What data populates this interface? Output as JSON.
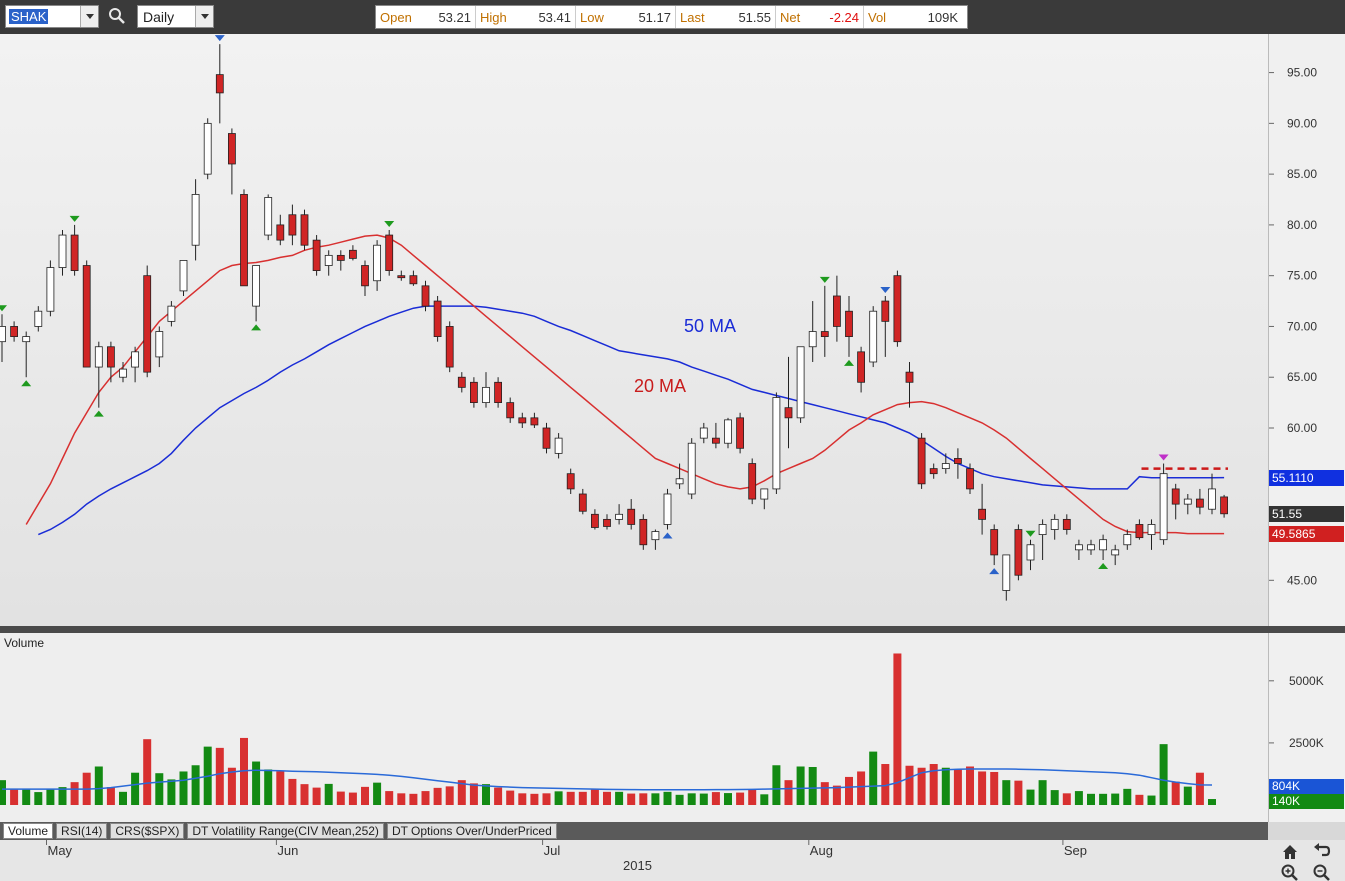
{
  "toolbar": {
    "symbol": "SHAK",
    "period": "Daily",
    "quote": [
      {
        "label": "Open",
        "value": "53.21",
        "negative": false
      },
      {
        "label": "High",
        "value": "53.41",
        "negative": false
      },
      {
        "label": "Low",
        "value": "51.17",
        "negative": false
      },
      {
        "label": "Last",
        "value": "51.55",
        "negative": false
      },
      {
        "label": "Net",
        "value": "-2.24",
        "negative": true
      },
      {
        "label": "Vol",
        "value": "109K",
        "negative": false
      }
    ]
  },
  "price_axis": {
    "labels": [
      "95.00",
      "90.00",
      "85.00",
      "80.00",
      "75.00",
      "70.00",
      "65.00",
      "60.00",
      "45.00"
    ],
    "values": [
      95,
      90,
      85,
      80,
      75,
      70,
      65,
      60,
      45
    ],
    "badges": [
      {
        "text": "55.1110",
        "value": 55.111,
        "color": "#1030e0"
      },
      {
        "text": "51.55",
        "value": 51.55,
        "color": "#333333"
      },
      {
        "text": "49.5865",
        "value": 49.5865,
        "color": "#d02020"
      }
    ]
  },
  "annotations": {
    "ma50_label": "50 MA",
    "ma20_label": "20 MA"
  },
  "volume_pane": {
    "title": "Volume",
    "axis_labels": [
      "5000K",
      "2500K"
    ],
    "axis_values": [
      5000,
      2500
    ],
    "badges": [
      {
        "text": "804K",
        "value": 804,
        "color": "#1a55d6"
      },
      {
        "text": "140K",
        "value": 140,
        "color": "#138a13"
      }
    ]
  },
  "tabs": [
    "Volume",
    "RSI(14)",
    "CRS($SPX)",
    "DT Volatility Range(CIV Mean,252)",
    "DT Options Over/UnderPriced"
  ],
  "date_axis": {
    "months": [
      "May",
      "Jun",
      "Jul",
      "Aug",
      "Sep"
    ],
    "year": "2015"
  },
  "colors": {
    "up_candle": "#ffffff",
    "down_candle": "#d02525",
    "ma20": "#d83030",
    "ma50": "#1a2cd6",
    "vol_up": "#138a13",
    "vol_down": "#d83030",
    "vol_ma": "#2a6ad8"
  },
  "chart_data": {
    "type": "candlestick",
    "y_range": [
      40.5,
      98.8
    ],
    "volume_range_k": [
      0,
      6200
    ],
    "candles": [
      {
        "o": 68.5,
        "h": 71.2,
        "l": 66.5,
        "c": 70.0
      },
      {
        "o": 70.0,
        "h": 70.5,
        "l": 68.5,
        "c": 69.0
      },
      {
        "o": 68.5,
        "h": 69.5,
        "l": 65.0,
        "c": 69.0
      },
      {
        "o": 70.0,
        "h": 72.0,
        "l": 69.5,
        "c": 71.5
      },
      {
        "o": 71.5,
        "h": 76.5,
        "l": 71.0,
        "c": 75.8
      },
      {
        "o": 75.8,
        "h": 79.5,
        "l": 75.0,
        "c": 79.0
      },
      {
        "o": 79.0,
        "h": 80.0,
        "l": 75.0,
        "c": 75.5
      },
      {
        "o": 76.0,
        "h": 76.5,
        "l": 66.0,
        "c": 66.0
      },
      {
        "o": 66.0,
        "h": 68.5,
        "l": 62.0,
        "c": 68.0
      },
      {
        "o": 68.0,
        "h": 68.5,
        "l": 64.5,
        "c": 66.0
      },
      {
        "o": 65.0,
        "h": 66.5,
        "l": 64.5,
        "c": 65.8
      },
      {
        "o": 66.0,
        "h": 68.0,
        "l": 64.5,
        "c": 67.5
      },
      {
        "o": 75.0,
        "h": 76.0,
        "l": 65.0,
        "c": 65.5
      },
      {
        "o": 67.0,
        "h": 70.0,
        "l": 66.0,
        "c": 69.5
      },
      {
        "o": 70.5,
        "h": 72.5,
        "l": 70.0,
        "c": 72.0
      },
      {
        "o": 73.5,
        "h": 76.5,
        "l": 73.0,
        "c": 76.5
      },
      {
        "o": 78.0,
        "h": 84.5,
        "l": 76.5,
        "c": 83.0
      },
      {
        "o": 85.0,
        "h": 90.5,
        "l": 84.5,
        "c": 90.0
      },
      {
        "o": 94.8,
        "h": 97.8,
        "l": 90.0,
        "c": 93.0
      },
      {
        "o": 89.0,
        "h": 89.5,
        "l": 83.0,
        "c": 86.0
      },
      {
        "o": 83.0,
        "h": 83.5,
        "l": 74.0,
        "c": 74.0
      },
      {
        "o": 72.0,
        "h": 76.0,
        "l": 70.5,
        "c": 76.0
      },
      {
        "o": 79.0,
        "h": 83.0,
        "l": 78.5,
        "c": 82.7
      },
      {
        "o": 80.0,
        "h": 81.0,
        "l": 78.0,
        "c": 78.5
      },
      {
        "o": 81.0,
        "h": 82.0,
        "l": 78.0,
        "c": 79.0
      },
      {
        "o": 81.0,
        "h": 81.5,
        "l": 77.5,
        "c": 78.0
      },
      {
        "o": 78.5,
        "h": 79.0,
        "l": 75.0,
        "c": 75.5
      },
      {
        "o": 76.0,
        "h": 77.5,
        "l": 75.0,
        "c": 77.0
      },
      {
        "o": 77.0,
        "h": 77.5,
        "l": 75.5,
        "c": 76.5
      },
      {
        "o": 77.5,
        "h": 78.0,
        "l": 76.5,
        "c": 76.7
      },
      {
        "o": 76.0,
        "h": 76.5,
        "l": 73.0,
        "c": 74.0
      },
      {
        "o": 74.5,
        "h": 78.5,
        "l": 73.5,
        "c": 78.0
      },
      {
        "o": 79.0,
        "h": 79.5,
        "l": 75.0,
        "c": 75.5
      },
      {
        "o": 75.0,
        "h": 75.5,
        "l": 74.5,
        "c": 74.8
      },
      {
        "o": 75.0,
        "h": 75.5,
        "l": 74.0,
        "c": 74.2
      },
      {
        "o": 74.0,
        "h": 74.5,
        "l": 71.5,
        "c": 72.0
      },
      {
        "o": 72.5,
        "h": 73.0,
        "l": 68.5,
        "c": 69.0
      },
      {
        "o": 70.0,
        "h": 70.5,
        "l": 65.5,
        "c": 66.0
      },
      {
        "o": 65.0,
        "h": 65.5,
        "l": 63.5,
        "c": 64.0
      },
      {
        "o": 64.5,
        "h": 65.0,
        "l": 62.0,
        "c": 62.5
      },
      {
        "o": 62.5,
        "h": 65.5,
        "l": 62.0,
        "c": 64.0
      },
      {
        "o": 64.5,
        "h": 65.0,
        "l": 62.0,
        "c": 62.5
      },
      {
        "o": 62.5,
        "h": 63.0,
        "l": 60.5,
        "c": 61.0
      },
      {
        "o": 61.0,
        "h": 61.5,
        "l": 60.0,
        "c": 60.5
      },
      {
        "o": 61.0,
        "h": 61.5,
        "l": 60.0,
        "c": 60.3
      },
      {
        "o": 60.0,
        "h": 60.5,
        "l": 57.5,
        "c": 58.0
      },
      {
        "o": 57.5,
        "h": 59.5,
        "l": 57.0,
        "c": 59.0
      },
      {
        "o": 55.5,
        "h": 56.0,
        "l": 53.5,
        "c": 54.0
      },
      {
        "o": 53.5,
        "h": 54.0,
        "l": 51.5,
        "c": 51.8
      },
      {
        "o": 51.5,
        "h": 52.0,
        "l": 50.0,
        "c": 50.2
      },
      {
        "o": 51.0,
        "h": 51.5,
        "l": 50.0,
        "c": 50.3
      },
      {
        "o": 51.0,
        "h": 52.5,
        "l": 50.5,
        "c": 51.5
      },
      {
        "o": 52.0,
        "h": 53.0,
        "l": 50.0,
        "c": 50.5
      },
      {
        "o": 51.0,
        "h": 51.5,
        "l": 48.0,
        "c": 48.5
      },
      {
        "o": 49.0,
        "h": 50.0,
        "l": 48.0,
        "c": 49.8
      },
      {
        "o": 50.5,
        "h": 54.0,
        "l": 50.0,
        "c": 53.5
      },
      {
        "o": 54.5,
        "h": 56.5,
        "l": 54.0,
        "c": 55.0
      },
      {
        "o": 53.5,
        "h": 59.0,
        "l": 53.0,
        "c": 58.5
      },
      {
        "o": 59.0,
        "h": 60.5,
        "l": 58.5,
        "c": 60.0
      },
      {
        "o": 59.0,
        "h": 60.5,
        "l": 58.0,
        "c": 58.5
      },
      {
        "o": 58.5,
        "h": 61.0,
        "l": 58.0,
        "c": 60.8
      },
      {
        "o": 61.0,
        "h": 61.5,
        "l": 57.5,
        "c": 58.0
      },
      {
        "o": 56.5,
        "h": 57.0,
        "l": 52.5,
        "c": 53.0
      },
      {
        "o": 53.0,
        "h": 54.0,
        "l": 52.0,
        "c": 54.0
      },
      {
        "o": 54.0,
        "h": 63.5,
        "l": 53.5,
        "c": 63.0
      },
      {
        "o": 62.0,
        "h": 67.0,
        "l": 58.0,
        "c": 61.0
      },
      {
        "o": 61.0,
        "h": 68.0,
        "l": 60.5,
        "c": 68.0
      },
      {
        "o": 68.0,
        "h": 72.5,
        "l": 66.5,
        "c": 69.5
      },
      {
        "o": 69.5,
        "h": 74.0,
        "l": 67.0,
        "c": 69.0
      },
      {
        "o": 73.0,
        "h": 75.0,
        "l": 68.5,
        "c": 70.0
      },
      {
        "o": 71.5,
        "h": 73.0,
        "l": 67.0,
        "c": 69.0
      },
      {
        "o": 67.5,
        "h": 68.0,
        "l": 63.5,
        "c": 64.5
      },
      {
        "o": 66.5,
        "h": 72.0,
        "l": 66.0,
        "c": 71.5
      },
      {
        "o": 72.5,
        "h": 73.0,
        "l": 67.0,
        "c": 70.5
      },
      {
        "o": 75.0,
        "h": 75.5,
        "l": 68.0,
        "c": 68.5
      },
      {
        "o": 65.5,
        "h": 66.5,
        "l": 62.0,
        "c": 64.5
      },
      {
        "o": 59.0,
        "h": 59.5,
        "l": 54.0,
        "c": 54.5
      },
      {
        "o": 56.0,
        "h": 56.5,
        "l": 55.0,
        "c": 55.5
      },
      {
        "o": 56.0,
        "h": 57.5,
        "l": 55.5,
        "c": 56.5
      },
      {
        "o": 57.0,
        "h": 58.0,
        "l": 55.0,
        "c": 56.5
      },
      {
        "o": 56.0,
        "h": 56.5,
        "l": 53.5,
        "c": 54.0
      },
      {
        "o": 52.0,
        "h": 54.5,
        "l": 49.5,
        "c": 51.0
      },
      {
        "o": 50.0,
        "h": 50.5,
        "l": 46.5,
        "c": 47.5
      },
      {
        "o": 44.0,
        "h": 47.5,
        "l": 43.0,
        "c": 47.5
      },
      {
        "o": 50.0,
        "h": 50.5,
        "l": 45.0,
        "c": 45.5
      },
      {
        "o": 47.0,
        "h": 49.0,
        "l": 46.0,
        "c": 48.5
      },
      {
        "o": 49.5,
        "h": 51.0,
        "l": 47.0,
        "c": 50.5
      },
      {
        "o": 50.0,
        "h": 51.5,
        "l": 49.0,
        "c": 51.0
      },
      {
        "o": 51.0,
        "h": 51.5,
        "l": 49.5,
        "c": 50.0
      },
      {
        "o": 48.0,
        "h": 49.0,
        "l": 47.0,
        "c": 48.5
      },
      {
        "o": 48.0,
        "h": 49.0,
        "l": 47.5,
        "c": 48.5
      },
      {
        "o": 48.0,
        "h": 49.5,
        "l": 47.0,
        "c": 49.0
      },
      {
        "o": 47.5,
        "h": 48.5,
        "l": 46.5,
        "c": 48.0
      },
      {
        "o": 48.5,
        "h": 50.0,
        "l": 48.0,
        "c": 49.5
      },
      {
        "o": 50.5,
        "h": 51.0,
        "l": 49.0,
        "c": 49.2
      },
      {
        "o": 49.5,
        "h": 51.0,
        "l": 48.0,
        "c": 50.5
      },
      {
        "o": 49.0,
        "h": 56.5,
        "l": 48.5,
        "c": 55.5
      },
      {
        "o": 54.0,
        "h": 54.5,
        "l": 51.0,
        "c": 52.5
      },
      {
        "o": 52.5,
        "h": 53.5,
        "l": 51.5,
        "c": 53.0
      },
      {
        "o": 53.0,
        "h": 54.0,
        "l": 51.5,
        "c": 52.2
      },
      {
        "o": 52.0,
        "h": 55.5,
        "l": 51.5,
        "c": 54.0
      },
      {
        "o": 53.21,
        "h": 53.41,
        "l": 51.17,
        "c": 51.55
      }
    ],
    "volume_k": [
      1000,
      620,
      620,
      520,
      620,
      720,
      920,
      1300,
      1550,
      720,
      530,
      1300,
      2650,
      1280,
      1030,
      1350,
      1600,
      2350,
      2300,
      1500,
      2700,
      1750,
      1430,
      1350,
      1050,
      840,
      700,
      850,
      540,
      500,
      730,
      900,
      560,
      470,
      450,
      560,
      690,
      750,
      1000,
      870,
      840,
      700,
      580,
      470,
      450,
      470,
      550,
      530,
      530,
      620,
      530,
      530,
      460,
      470,
      470,
      530,
      410,
      470,
      460,
      520,
      480,
      500,
      620,
      430,
      1600,
      1000,
      1550,
      1530,
      920,
      780,
      1130,
      1350,
      2150,
      1650,
      6100,
      1580,
      1500,
      1650,
      1500,
      1450,
      1550,
      1350,
      1330,
      1000,
      980,
      620,
      1000,
      600,
      470,
      560,
      450,
      450,
      460,
      650,
      410,
      380,
      2450,
      940,
      740,
      1300,
      240
    ],
    "ma20": [
      null,
      null,
      50.5,
      52.5,
      54.5,
      57.0,
      59.5,
      61.5,
      63.5,
      65.0,
      66.0,
      67.5,
      69.0,
      70.5,
      71.5,
      72.5,
      73.5,
      74.5,
      75.5,
      76.0,
      76.2,
      76.3,
      76.5,
      76.8,
      77.0,
      77.5,
      77.8,
      78.0,
      78.3,
      78.6,
      78.9,
      79.0,
      78.7,
      78.0,
      77.0,
      76.0,
      75.0,
      74.0,
      73.0,
      72.0,
      71.0,
      70.0,
      69.0,
      68.0,
      67.0,
      66.0,
      65.0,
      64.0,
      63.0,
      62.0,
      61.0,
      60.0,
      59.0,
      58.0,
      57.0,
      56.5,
      56.0,
      55.5,
      55.0,
      54.5,
      54.2,
      54.0,
      54.2,
      54.8,
      55.5,
      56.0,
      56.5,
      57.0,
      57.8,
      58.8,
      59.8,
      60.5,
      61.3,
      61.8,
      62.3,
      62.5,
      62.6,
      62.4,
      62.0,
      61.5,
      61.0,
      60.5,
      59.8,
      59.0,
      58.0,
      57.0,
      56.0,
      55.0,
      54.0,
      53.0,
      52.0,
      51.0,
      50.3,
      49.8,
      49.7,
      49.7,
      49.7,
      49.7,
      49.6,
      49.6,
      49.6,
      49.6
    ],
    "ma50": [
      null,
      null,
      null,
      49.5,
      50.0,
      50.7,
      51.5,
      52.5,
      53.3,
      54.0,
      54.6,
      55.2,
      55.8,
      56.5,
      57.5,
      58.8,
      60.0,
      61.0,
      62.0,
      62.7,
      63.4,
      64.0,
      64.7,
      65.5,
      66.2,
      66.8,
      67.5,
      68.2,
      68.8,
      69.4,
      70.0,
      70.5,
      71.0,
      71.4,
      71.8,
      72.0,
      72.0,
      72.0,
      72.0,
      72.0,
      71.9,
      71.7,
      71.5,
      71.3,
      71.0,
      70.5,
      70.0,
      69.6,
      69.1,
      68.6,
      68.1,
      67.6,
      67.4,
      67.2,
      67.0,
      66.8,
      66.5,
      66.0,
      65.6,
      65.2,
      64.8,
      64.3,
      63.8,
      63.5,
      63.2,
      62.9,
      62.6,
      62.3,
      62.0,
      61.7,
      61.4,
      61.1,
      60.8,
      60.5,
      60.0,
      59.5,
      58.8,
      58.0,
      57.2,
      56.5,
      56.0,
      55.5,
      55.2,
      55.0,
      54.8,
      54.6,
      54.4,
      54.3,
      54.2,
      54.1,
      54.0,
      54.0,
      54.0,
      54.0,
      55.2,
      55.1,
      55.1,
      55.1,
      55.1,
      55.1,
      55.1,
      55.11
    ],
    "vol_ma_k": [
      640,
      640,
      640,
      640,
      640,
      640,
      640,
      640,
      660,
      700,
      760,
      820,
      880,
      920,
      960,
      1000,
      1080,
      1160,
      1260,
      1330,
      1380,
      1400,
      1390,
      1380,
      1360,
      1350,
      1340,
      1320,
      1300,
      1280,
      1260,
      1230,
      1200,
      1150,
      1100,
      1040,
      980,
      920,
      860,
      800,
      770,
      740,
      720,
      700,
      690,
      680,
      670,
      660,
      650,
      640,
      630,
      625,
      620,
      615,
      615,
      615,
      615,
      615,
      615,
      620,
      620,
      625,
      630,
      640,
      650,
      660,
      670,
      680,
      690,
      700,
      720,
      740,
      760,
      780,
      900,
      1100,
      1300,
      1380,
      1420,
      1440,
      1450,
      1450,
      1450,
      1450,
      1440,
      1430,
      1420,
      1400,
      1380,
      1360,
      1340,
      1320,
      1300,
      1260,
      1200,
      1100,
      1000,
      920,
      860,
      810,
      804
    ],
    "markers": [
      {
        "i": 0,
        "pos": "above",
        "color": "#1e9a1e"
      },
      {
        "i": 2,
        "pos": "below",
        "color": "#1e9a1e"
      },
      {
        "i": 6,
        "pos": "above",
        "color": "#1e9a1e"
      },
      {
        "i": 8,
        "pos": "below",
        "color": "#1e9a1e"
      },
      {
        "i": 18,
        "pos": "above",
        "color": "#2a62c9"
      },
      {
        "i": 21,
        "pos": "below",
        "color": "#1e9a1e"
      },
      {
        "i": 32,
        "pos": "above",
        "color": "#1e9a1e"
      },
      {
        "i": 55,
        "pos": "below",
        "color": "#2a62c9"
      },
      {
        "i": 68,
        "pos": "above",
        "color": "#1e9a1e"
      },
      {
        "i": 70,
        "pos": "below",
        "color": "#1e9a1e"
      },
      {
        "i": 73,
        "pos": "above",
        "color": "#2a62c9"
      },
      {
        "i": 82,
        "pos": "below",
        "color": "#2a62c9"
      },
      {
        "i": 85,
        "pos": "above",
        "color": "#1e9a1e"
      },
      {
        "i": 91,
        "pos": "below",
        "color": "#1e9a1e"
      },
      {
        "i": 96,
        "pos": "above",
        "color": "#c030c8"
      }
    ],
    "resistance_level": 56.0,
    "resistance_from_index": 95
  }
}
